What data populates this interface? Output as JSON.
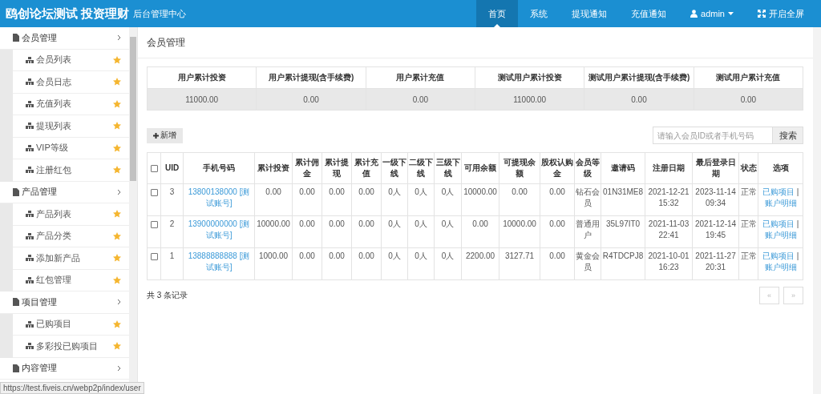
{
  "header": {
    "brand_title": "鸥创论坛测试 投资理财",
    "brand_subtitle": "后台管理中心",
    "nav": [
      {
        "label": "首页",
        "kind": "link",
        "selected": true
      },
      {
        "label": "系统",
        "kind": "link",
        "selected": false
      },
      {
        "label": "提现通知",
        "kind": "link",
        "selected": false
      },
      {
        "label": "充值通知",
        "kind": "link",
        "selected": false
      },
      {
        "label": "admin",
        "kind": "user",
        "selected": false
      },
      {
        "label": "开启全屏",
        "kind": "fullscreen",
        "selected": false
      }
    ]
  },
  "sidebar": {
    "groups": [
      {
        "label": "会员管理",
        "children": [
          {
            "label": "会员列表"
          },
          {
            "label": "会员日志"
          },
          {
            "label": "充值列表"
          },
          {
            "label": "提现列表"
          },
          {
            "label": "VIP等级"
          },
          {
            "label": "注册红包"
          }
        ]
      },
      {
        "label": "产品管理",
        "children": [
          {
            "label": "产品列表"
          },
          {
            "label": "产品分类"
          },
          {
            "label": "添加新产品"
          },
          {
            "label": "红包管理"
          }
        ]
      },
      {
        "label": "项目管理",
        "children": [
          {
            "label": "已购项目"
          },
          {
            "label": "多彩投已购项目"
          }
        ]
      },
      {
        "label": "内容管理"
      }
    ]
  },
  "page_title": "会员管理",
  "summary": {
    "columns": [
      "用户累计投资",
      "用户累计提现(含手续费)",
      "用户累计充值",
      "测试用户累计投资",
      "测试用户累计提现(含手续费)",
      "测试用户累计充值"
    ],
    "values": [
      "11000.00",
      "0.00",
      "0.00",
      "11000.00",
      "0.00",
      "0.00"
    ]
  },
  "add_button": "新增",
  "search": {
    "placeholder": "请输入会员ID或者手机号码",
    "button": "搜索"
  },
  "members": {
    "all_checked": false,
    "columns": [
      "UID",
      "手机号码",
      "累计投资",
      "累计佣金",
      "累计提现",
      "累计充值",
      "一级下线",
      "二级下线",
      "三级下线",
      "可用余额",
      "可提现余额",
      "股权认购金",
      "会员等级",
      "邀请码",
      "注册日期",
      "最后登录日期",
      "状态",
      "选项"
    ],
    "option_separator": "|",
    "rows": [
      {
        "checked": false,
        "cells": [
          "3",
          "13800138000 [测试账号]",
          "0.00",
          "0.00",
          "0.00",
          "0.00",
          "0人",
          "0人",
          "0人",
          "10000.00",
          "0.00",
          "0.00",
          "钻石会员",
          "01N31ME8",
          "2021-12-21 15:32",
          "2023-11-14 09:34",
          "正常"
        ],
        "options": [
          "已购项目",
          "账户明细"
        ]
      },
      {
        "checked": false,
        "cells": [
          "2",
          "13900000000 [测试账号]",
          "10000.00",
          "0.00",
          "0.00",
          "0.00",
          "0人",
          "0人",
          "0人",
          "0.00",
          "10000.00",
          "0.00",
          "普通用户",
          "35L97IT0",
          "2021-11-03 22:41",
          "2021-12-14 19:45",
          "正常"
        ],
        "options": [
          "已购项目",
          "账户明细"
        ]
      },
      {
        "checked": false,
        "cells": [
          "1",
          "13888888888 [测试账号]",
          "1000.00",
          "0.00",
          "0.00",
          "0.00",
          "0人",
          "0人",
          "0人",
          "2200.00",
          "3127.71",
          "0.00",
          "黄金会员",
          "R4TDCPJ8",
          "2021-10-01 16:23",
          "2021-11-27 20:31",
          "正常"
        ],
        "options": [
          "已购项目",
          "账户明细"
        ]
      }
    ]
  },
  "record_count": "共 3 条记录",
  "pagination": [
    {
      "label": "«",
      "disabled": true
    },
    {
      "label": "»",
      "disabled": true
    }
  ],
  "status_url": "https://test.fiveis.cn/webp2p/index/user"
}
